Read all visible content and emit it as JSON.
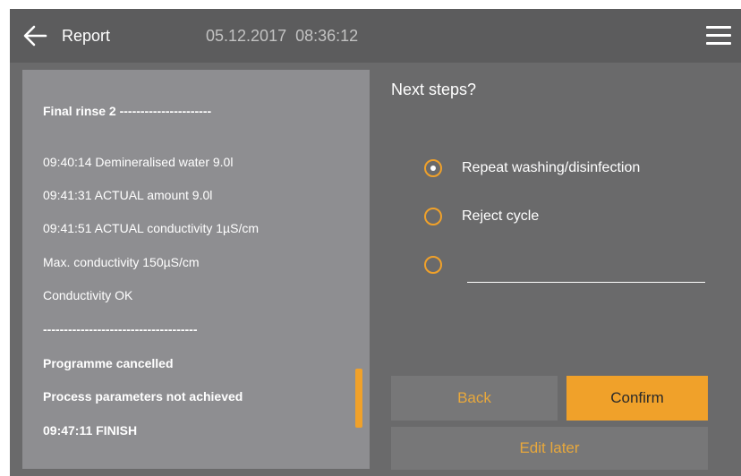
{
  "header": {
    "title": "Report",
    "datetime": "05.12.2017  08:36:12",
    "back_icon": "arrow-left-icon",
    "menu_icon": "hamburger-menu-icon"
  },
  "log": {
    "lines": [
      "Final rinse 2 ----------------------",
      "09:40:14 Demineralised water 9.0l",
      "09:41:31 ACTUAL amount 9.0l",
      "09:41:51 ACTUAL conductivity 1µS/cm",
      "Max. conductivity 150µS/cm",
      "Conductivity OK",
      "-------------------------------------",
      "Programme cancelled",
      "Process parameters not achieved",
      "09:47:11 FINISH"
    ],
    "scroll_position": 0.85
  },
  "next_steps": {
    "question": "Next steps?",
    "options": [
      {
        "label": "Repeat washing/disinfection",
        "selected": true
      },
      {
        "label": "Reject cycle",
        "selected": false
      },
      {
        "label": "",
        "selected": false
      }
    ],
    "custom_value": ""
  },
  "buttons": {
    "back": "Back",
    "confirm": "Confirm",
    "edit_later": "Edit later"
  },
  "colors": {
    "accent": "#f0a12a",
    "background": "#6a6a6b",
    "header": "#5c5c5d",
    "panel": "#8e8e91",
    "disabled_button": "#777778"
  }
}
